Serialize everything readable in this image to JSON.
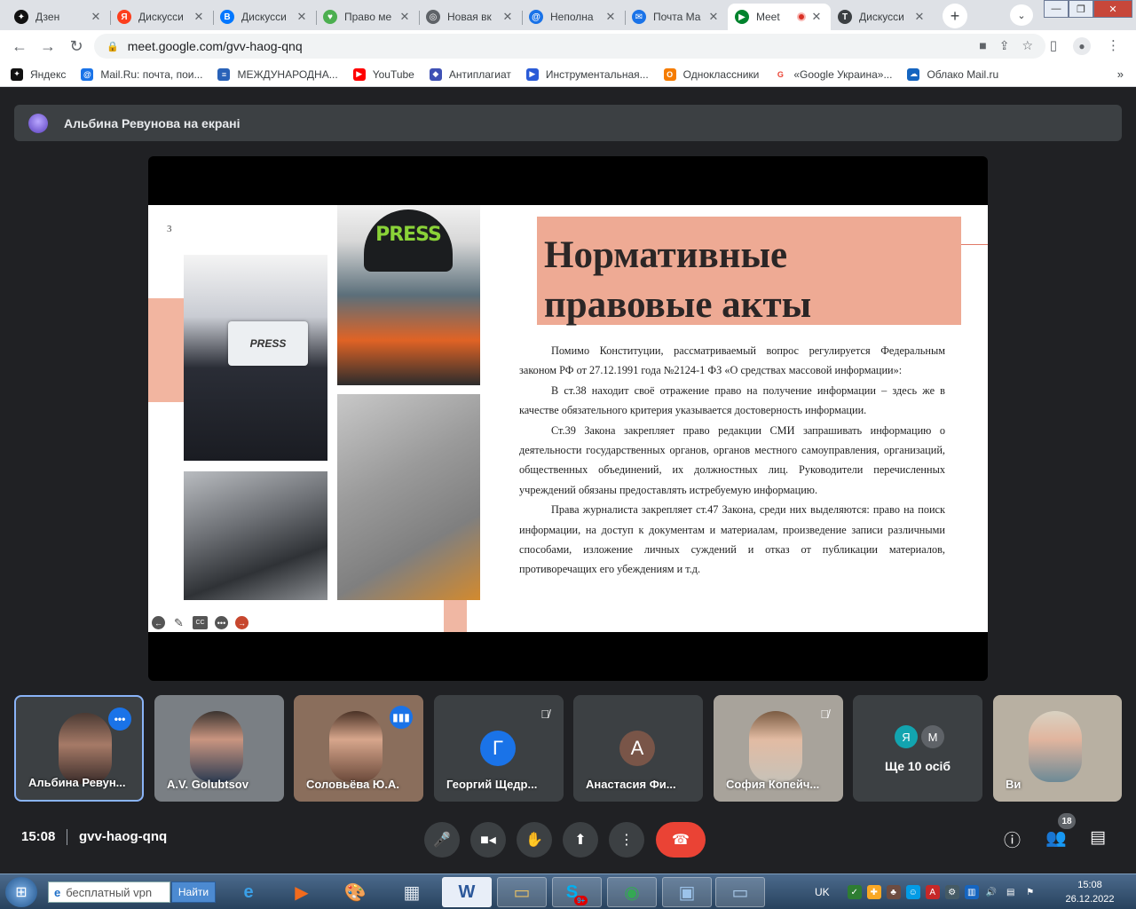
{
  "tabs": [
    {
      "label": "Дзен",
      "fav_color": "#111111",
      "fav_glyph": "✦"
    },
    {
      "label": "Дискусси",
      "fav_color": "#fc3f1d",
      "fav_glyph": "Я"
    },
    {
      "label": "Дискусси",
      "fav_color": "#0077ff",
      "fav_glyph": "В"
    },
    {
      "label": "Право ме",
      "fav_color": "#4caf50",
      "fav_glyph": "♥"
    },
    {
      "label": "Новая вк",
      "fav_color": "#5f6368",
      "fav_glyph": "◎"
    },
    {
      "label": "Неполна",
      "fav_color": "#1a73e8",
      "fav_glyph": "@"
    },
    {
      "label": "Почта Ма",
      "fav_color": "#1a73e8",
      "fav_glyph": "✉"
    },
    {
      "label": "Meet",
      "fav_color": "#00832d",
      "fav_glyph": "▶",
      "active": true
    },
    {
      "label": "Дискусси",
      "fav_color": "#3c4043",
      "fav_glyph": "T"
    }
  ],
  "address": {
    "url": "meet.google.com/gvv-haog-qnq"
  },
  "bookmarks": [
    {
      "label": "Яндекс",
      "color": "#111111",
      "glyph": "✦"
    },
    {
      "label": "Mail.Ru: почта, пои...",
      "color": "#1a73e8",
      "glyph": "@"
    },
    {
      "label": "МЕЖДУНАРОДНА...",
      "color": "#2962b8",
      "glyph": "≡"
    },
    {
      "label": "YouTube",
      "color": "#ff0000",
      "glyph": "▶"
    },
    {
      "label": "Антиплагиат",
      "color": "#3f51b5",
      "glyph": "◆"
    },
    {
      "label": "Инструментальная...",
      "color": "#2a5bd7",
      "glyph": "▶"
    },
    {
      "label": "Одноклассники",
      "color": "#f57c00",
      "glyph": "О"
    },
    {
      "label": "«Google Украина»...",
      "color": "#ffffff",
      "glyph": "G"
    },
    {
      "label": "Облако Mail.ru",
      "color": "#1565c0",
      "glyph": "☁"
    }
  ],
  "meet": {
    "presenter_banner": "Альбина Ревунова на екрані",
    "time": "15:08",
    "meeting_code": "gvv-haog-qnq",
    "participants_count": "18"
  },
  "slide": {
    "page_number": "3",
    "title_line1": "Нормативные",
    "title_line2": "правовые акты",
    "card_text": "PRESS",
    "helmet_text": "PRESS",
    "paragraphs": [
      "Помимо Конституции, рассматриваемый вопрос регулируется Федеральным законом РФ от 27.12.1991 года №2124-1 ФЗ «О средствах массовой информации»:",
      "В ст.38 находит своё отражение право на получение информации – здесь же в качестве обязательного критерия указывается достоверность информации.",
      "Ст.39 Закона закрепляет право редакции СМИ запрашивать информацию о деятельности государственных органов, органов местного самоуправления, организаций, общественных объединений, их должностных лиц. Руководители перечисленных учреждений обязаны предоставлять истребуемую информацию.",
      "Права журналиста закрепляет ст.47 Закона, среди них выделяются: право на поиск информации, на доступ к документам и материалам, произведение записи различными способами, изложение личных суждений и отказ от публикации материалов, противоречащих его убеждениям и т.д."
    ],
    "cc_label": "CC"
  },
  "participants": [
    {
      "name": "Альбина Ревун...",
      "speaking": true,
      "active": true
    },
    {
      "name": "A.V. Golubtsov"
    },
    {
      "name": "Соловьёва Ю.А.",
      "speaking": true
    },
    {
      "name": "Георгий Щедр...",
      "muted": true,
      "initial": "Г",
      "color": "#1a73e8"
    },
    {
      "name": "Анастасия Фи...",
      "initial": "А",
      "color": "#795548"
    },
    {
      "name": "София Копейч...",
      "muted": true
    },
    {
      "more_label": "Ще 10 осіб",
      "avatars": [
        {
          "letter": "Я",
          "color": "#12a4af"
        },
        {
          "letter": "М",
          "color": "#5f6368"
        }
      ]
    },
    {
      "name": "Ви"
    }
  ],
  "taskbar": {
    "search_placeholder": "бесплатный vpn",
    "search_button": "Найти",
    "lang": "UK",
    "time": "15:08",
    "date": "26.12.2022",
    "skype_badge": "9+"
  }
}
